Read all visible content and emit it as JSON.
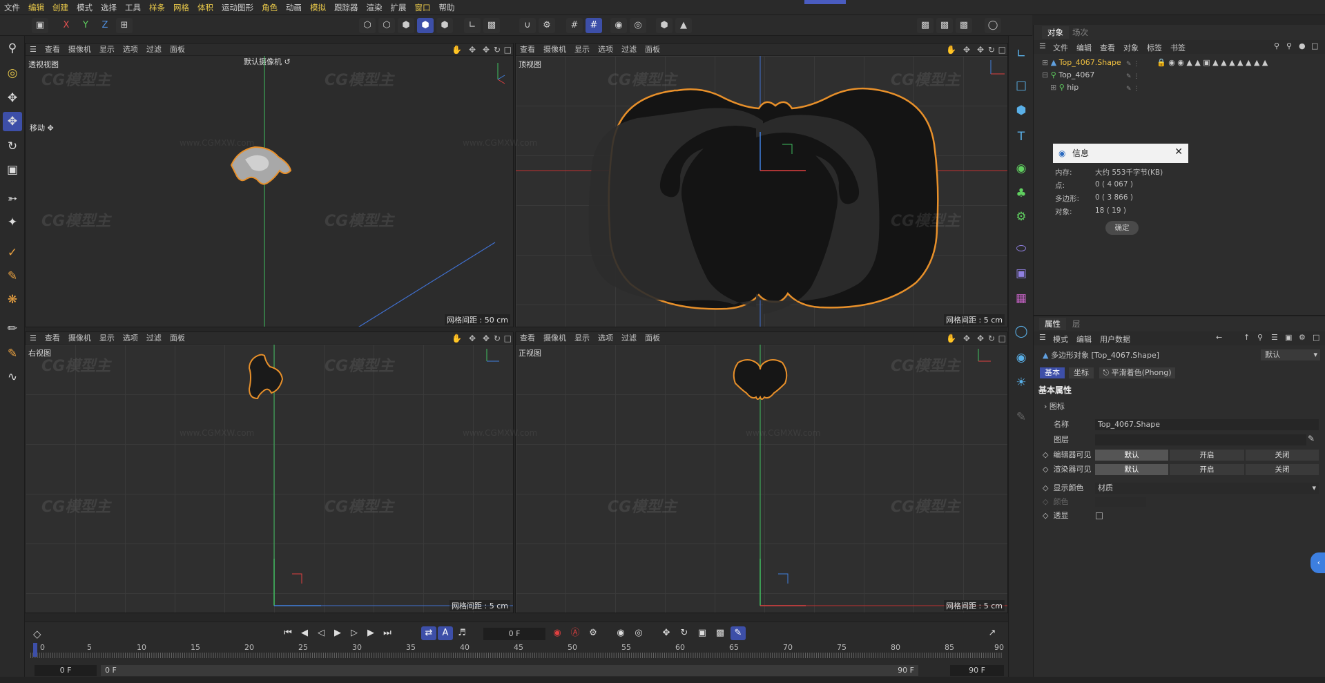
{
  "menu": [
    "文件",
    "编辑",
    "创建",
    "模式",
    "选择",
    "工具",
    "样条",
    "网格",
    "体积",
    "运动图形",
    "角色",
    "动画",
    "模拟",
    "跟踪器",
    "渲染",
    "扩展",
    "窗口",
    "帮助"
  ],
  "axes": {
    "x": "X",
    "y": "Y",
    "z": "Z"
  },
  "viewport_menu": [
    "查看",
    "摄像机",
    "显示",
    "选项",
    "过滤",
    "面板"
  ],
  "viewports": {
    "perspective": {
      "name": "透视视图",
      "camera": "默认摄像机",
      "tool": "移动",
      "grid": "网格间距 : 50 cm"
    },
    "top": {
      "name": "顶视图",
      "grid": "网格间距 : 5 cm"
    },
    "right": {
      "name": "右视图",
      "grid": "网格间距 : 5 cm"
    },
    "front": {
      "name": "正视图",
      "grid": "网格间距 : 5 cm"
    }
  },
  "watermark": {
    "brand": "CG模型主",
    "url": "www.CGMXW.com"
  },
  "object_manager": {
    "tabs": [
      "对象",
      "场次"
    ],
    "menu": [
      "文件",
      "编辑",
      "查看",
      "对象",
      "标签",
      "书签"
    ],
    "rows": [
      {
        "name": "Top_4067.Shape",
        "color": "#f0c040"
      },
      {
        "name": "Top_4067",
        "color": "#c8c8c8"
      },
      {
        "name": "hip",
        "color": "#c8c8c8"
      }
    ]
  },
  "info": {
    "title": "信息",
    "rows": [
      {
        "label": "内存:",
        "value": "大约 553千字节(KB)"
      },
      {
        "label": "点:",
        "value": "0 ( 4 067 )"
      },
      {
        "label": "多边形:",
        "value": "0 ( 3 866 )"
      },
      {
        "label": "对象:",
        "value": "18 ( 19 )"
      }
    ],
    "ok": "确定"
  },
  "attributes": {
    "tabs": [
      "属性",
      "层"
    ],
    "menu": [
      "模式",
      "编辑",
      "用户数据"
    ],
    "object_line": "多边形对象 [Top_4067.Shape]",
    "preset": "默认",
    "subtabs": [
      "基本",
      "坐标",
      "平滑着色(Phong)"
    ],
    "section": "基本属性",
    "icon_label": "图标",
    "name_label": "名称",
    "name_value": "Top_4067.Shape",
    "layer_label": "图层",
    "editor_visible": "编辑器可见",
    "render_visible": "渲染器可见",
    "options": [
      "默认",
      "开启",
      "关闭"
    ],
    "display_color": "显示颜色",
    "display_color_value": "材质",
    "color_label": "颜色",
    "xray": "透显"
  },
  "timeline": {
    "current_frame": "0 F",
    "ticks": [
      "0",
      "5",
      "10",
      "15",
      "20",
      "25",
      "30",
      "35",
      "40",
      "45",
      "50",
      "55",
      "60",
      "65",
      "70",
      "75",
      "80",
      "85",
      "90"
    ],
    "start": "0 F",
    "range_start": "0 F",
    "range_end": "90 F",
    "end": "90 F"
  },
  "colors": {
    "accent": "#3d4fa8",
    "selection": "#e8902a",
    "x_axis": "#e04040",
    "y_axis": "#40d060",
    "z_axis": "#4080e0"
  }
}
